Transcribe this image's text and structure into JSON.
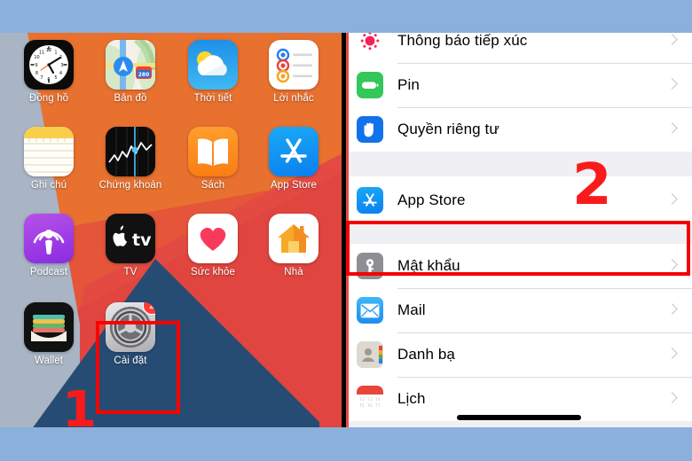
{
  "meta": {
    "annotation_color": "#f40000",
    "marker_color": "#f91b1b",
    "backdrop_color": "#8cb0dc"
  },
  "home_screen": {
    "name": "iphone-home-screen",
    "wallpaper_colors": [
      "#e8712f",
      "#e34b42",
      "#a9b4c4",
      "#274c74"
    ],
    "apps": [
      {
        "label": "Đồng hồ",
        "icon": "clock-icon",
        "badge": null
      },
      {
        "label": "Bản đồ",
        "icon": "maps-icon",
        "badge": null
      },
      {
        "label": "Thời tiết",
        "icon": "weather-icon",
        "badge": null
      },
      {
        "label": "Lời nhắc",
        "icon": "reminders-icon",
        "badge": null
      },
      {
        "label": "Ghi chú",
        "icon": "notes-icon",
        "badge": null
      },
      {
        "label": "Chứng khoán",
        "icon": "stocks-icon",
        "badge": null
      },
      {
        "label": "Sách",
        "icon": "books-icon",
        "badge": null
      },
      {
        "label": "App Store",
        "icon": "appstore-icon",
        "badge": null
      },
      {
        "label": "Podcast",
        "icon": "podcasts-icon",
        "badge": null
      },
      {
        "label": "TV",
        "icon": "appletv-icon",
        "badge": null
      },
      {
        "label": "Sức khỏe",
        "icon": "health-icon",
        "badge": null
      },
      {
        "label": "Nhà",
        "icon": "home-icon",
        "badge": null
      },
      {
        "label": "Wallet",
        "icon": "wallet-icon",
        "badge": null
      },
      {
        "label": "Cài đặt",
        "icon": "settings-icon",
        "badge": "2"
      }
    ],
    "step_marker": "1"
  },
  "settings_screen": {
    "name": "ios-settings-list",
    "step_marker": "2",
    "groups": [
      {
        "rows": [
          {
            "label": "Thông báo tiếp xúc",
            "icon": "exposure-notification-icon"
          },
          {
            "label": "Pin",
            "icon": "battery-icon"
          },
          {
            "label": "Quyền riêng tư",
            "icon": "privacy-hand-icon"
          }
        ]
      },
      {
        "rows": [
          {
            "label": "App Store",
            "icon": "appstore-icon",
            "highlighted": true
          }
        ]
      },
      {
        "rows": [
          {
            "label": "Mật khẩu",
            "icon": "passwords-key-icon"
          },
          {
            "label": "Mail",
            "icon": "mail-icon"
          },
          {
            "label": "Danh bạ",
            "icon": "contacts-icon"
          },
          {
            "label": "Lịch",
            "icon": "calendar-icon"
          }
        ]
      }
    ]
  }
}
